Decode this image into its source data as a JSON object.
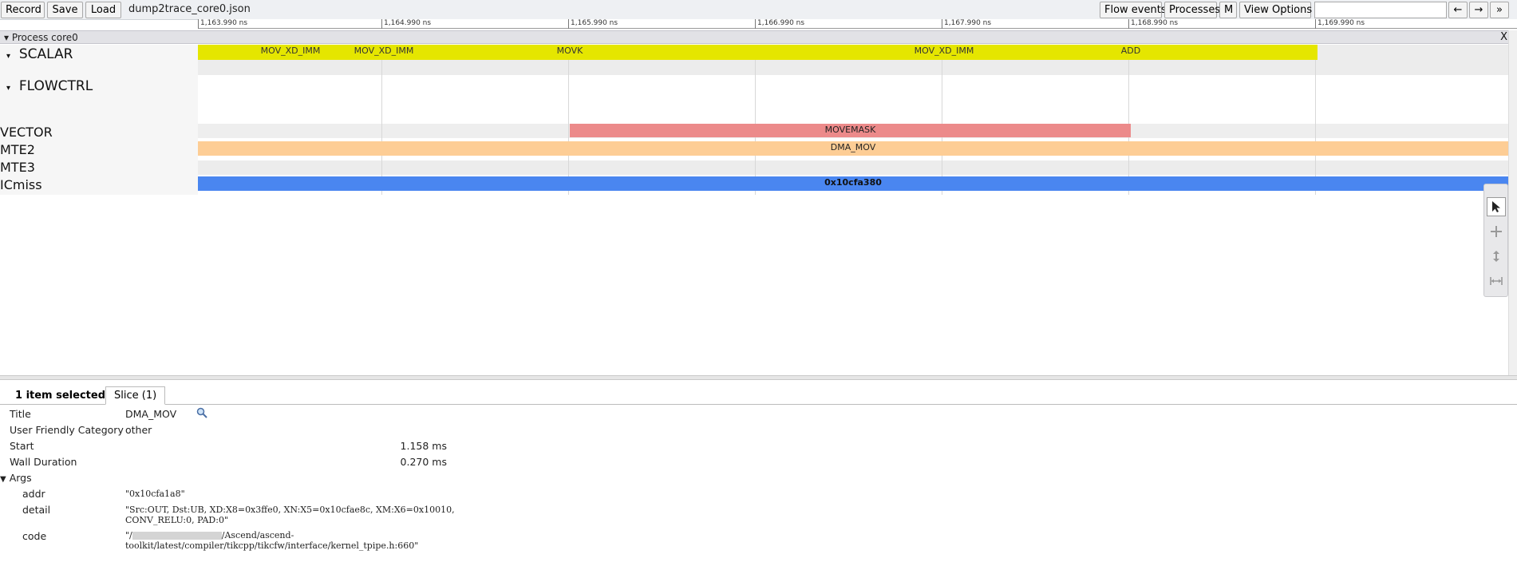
{
  "toolbar": {
    "record": "Record",
    "save": "Save",
    "load": "Load",
    "filename": "dump2trace_core0.json",
    "flow_events": "Flow events",
    "processes": "Processes",
    "m": "M",
    "view_options": "View Options",
    "search_placeholder": "",
    "prev": "←",
    "next": "→",
    "more": "»"
  },
  "ruler": {
    "ticks": [
      "1,163.990 ns",
      "1,164.990 ns",
      "1,165.990 ns",
      "1,166.990 ns",
      "1,167.990 ns",
      "1,168.990 ns",
      "1,169.990 ns"
    ]
  },
  "process": {
    "title": "Process core0",
    "close": "X"
  },
  "tracks": {
    "scalar": "SCALAR",
    "flowctrl": "FLOWCTRL",
    "vector": "VECTOR",
    "mte2": "MTE2",
    "mte3": "MTE3",
    "icmiss": "ICmiss"
  },
  "slices": {
    "scalar": [
      "MOV_XD_IMM",
      "MOV_XD_IMM",
      "MOVK",
      "MOV_XD_IMM",
      "ADD"
    ],
    "vector": "MOVEMASK",
    "mte2": "DMA_MOV",
    "icmiss": "0x10cfa380"
  },
  "colors": {
    "scalar": "#e5e600",
    "vector": "#ec8a8a",
    "mte2": "#fdcd95",
    "icmiss": "#4a86f0"
  },
  "analysis": {
    "selected_text": "1 item selected.",
    "tab": "Slice (1)",
    "title_label": "Title",
    "title_value": "DMA_MOV",
    "category_label": "User Friendly Category",
    "category_value": "other",
    "start_label": "Start",
    "start_value": "1.158 ms",
    "duration_label": "Wall Duration",
    "duration_value": "0.270 ms",
    "args_label": "Args",
    "addr_label": "addr",
    "addr_value": "\"0x10cfa1a8\"",
    "detail_label": "detail",
    "detail_line1": "\"Src:OUT, Dst:UB, XD:X8=0x3ffe0, XN:X5=0x10cfae8c, XM:X6=0x10010,",
    "detail_line2": "CONV_RELU:0, PAD:0\"",
    "code_label": "code",
    "code_line1_pre": "\"/",
    "code_line1_post": "/Ascend/ascend-",
    "code_line2": "toolkit/latest/compiler/tikcpp/tikcfw/interface/kernel_tpipe.h:660\""
  }
}
